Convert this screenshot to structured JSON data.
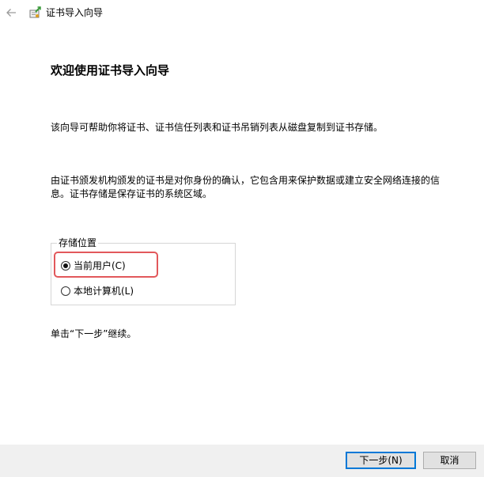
{
  "window": {
    "title": "证书导入向导",
    "icons": {
      "back": "back-arrow-icon",
      "app": "certificate-wizard-icon"
    }
  },
  "content": {
    "heading": "欢迎使用证书导入向导",
    "intro": "该向导可帮助你将证书、证书信任列表和证书吊销列表从磁盘复制到证书存储。",
    "description": "由证书颁发机构颁发的证书是对你身份的确认，它包含用来保护数据或建立安全网络连接的信息。证书存储是保存证书的系统区域。",
    "store_location": {
      "legend": "存储位置",
      "options": [
        {
          "label": "当前用户(C)",
          "checked": true
        },
        {
          "label": "本地计算机(L)",
          "checked": false
        }
      ]
    },
    "continue_hint": "单击“下一步”继续。"
  },
  "footer": {
    "next_label": "下一步(N)",
    "cancel_label": "取消"
  },
  "colors": {
    "highlight": "#e2585b",
    "default_button_border": "#0078d7",
    "footer_bg": "#f0f0f0"
  }
}
